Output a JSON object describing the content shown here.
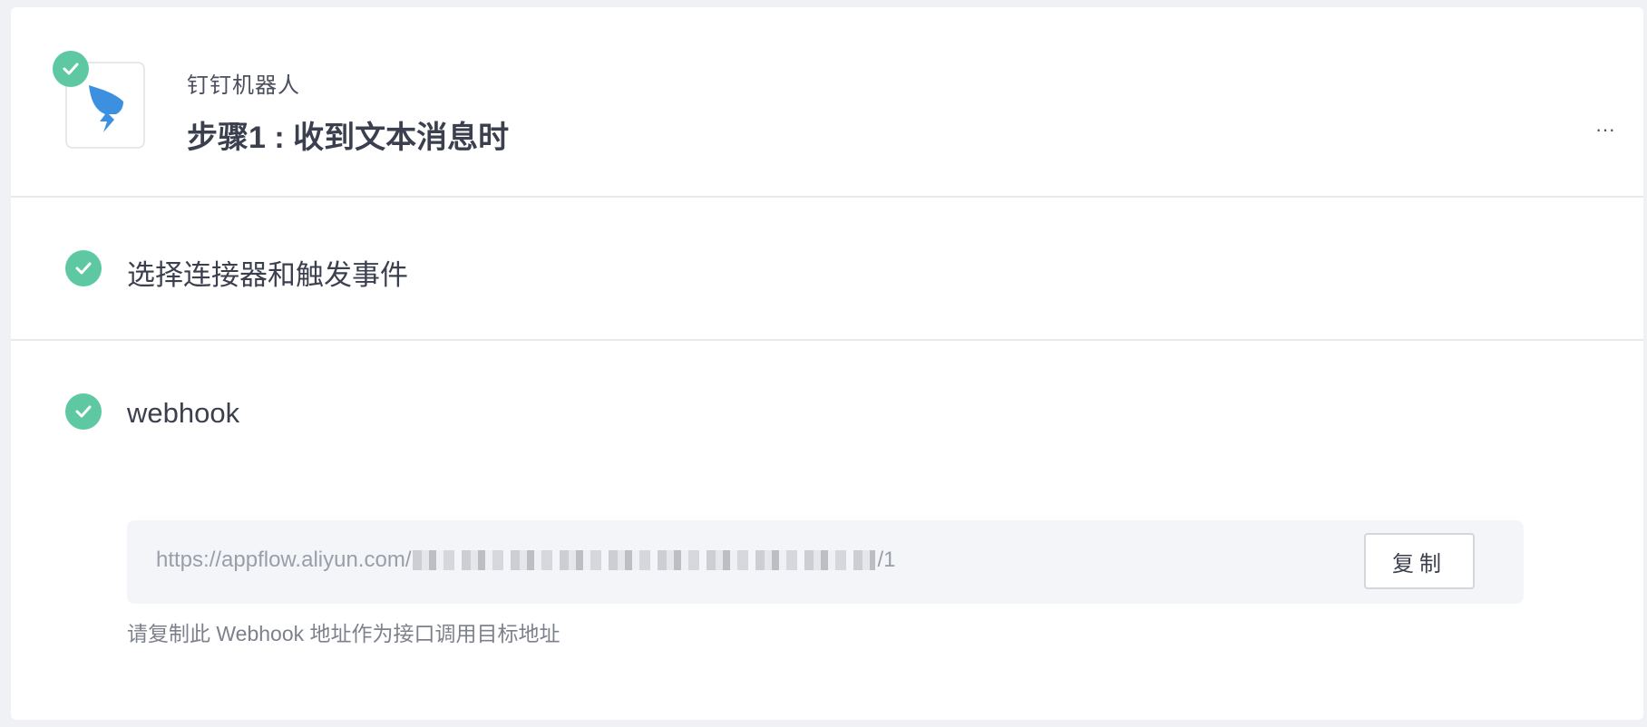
{
  "header": {
    "app_name": "钉钉机器人",
    "step_title": "步骤1 : 收到文本消息时",
    "more_label": "···"
  },
  "sections": [
    {
      "label": "选择连接器和触发事件",
      "status": "done"
    },
    {
      "label": "webhook",
      "status": "done"
    }
  ],
  "webhook": {
    "url_prefix": "https://appflow.aliyun.com/",
    "url_suffix": "/1",
    "copy_label": "复制",
    "hint": "请复制此 Webhook 地址作为接口调用目标地址"
  },
  "colors": {
    "success": "#5ec8a3",
    "brand": "#3d8fe0"
  },
  "icons": {
    "app": "dingtalk-icon",
    "status": "check-icon"
  }
}
